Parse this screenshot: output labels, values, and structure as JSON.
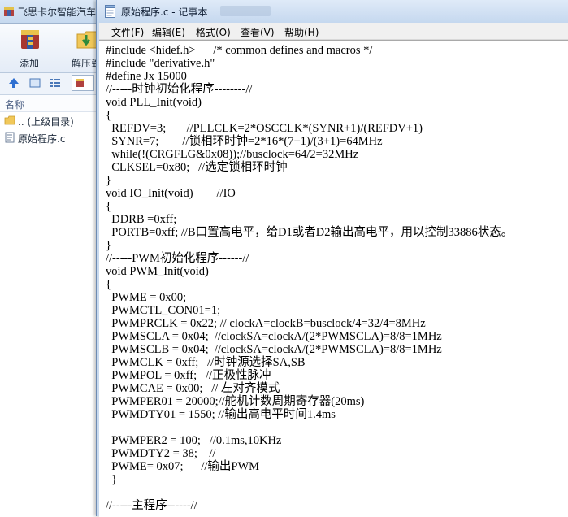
{
  "explorer": {
    "title": "飞思卡尔智能汽车",
    "ribbon": {
      "add_label": "添加",
      "extract_label": "解压到"
    },
    "list_header": "名称",
    "rows": [
      {
        "icon": "folder-up-icon",
        "label": ".. (上级目录)"
      },
      {
        "icon": "text-file-icon",
        "label": "原始程序.c"
      }
    ]
  },
  "notepad": {
    "title": "原始程序.c - 记事本",
    "menu": [
      {
        "label": "文件(F)"
      },
      {
        "label": "编辑(E)"
      },
      {
        "label": "格式(O)"
      },
      {
        "label": "查看(V)"
      },
      {
        "label": "帮助(H)"
      }
    ],
    "lines": [
      "#include <hidef.h>      /* common defines and macros */",
      "#include \"derivative.h\"",
      "#define Jx 15000",
      "//-----时钟初始化程序--------//",
      "void PLL_Init(void)",
      "{",
      "  REFDV=3;       //PLLCLK=2*OSCCLK*(SYNR+1)/(REFDV+1)",
      "  SYNR=7;        //锁相环时钟=2*16*(7+1)/(3+1)=64MHz",
      "  while(!(CRGFLG&0x08));//busclock=64/2=32MHz",
      "  CLKSEL=0x80;   //选定锁相环时钟",
      "}",
      "void IO_Init(void)        //IO",
      "{",
      "  DDRB =0xff;",
      "  PORTB=0xff; //B口置高电平，给D1或者D2输出高电平，用以控制33886状态。",
      "}",
      "//-----PWM初始化程序------//",
      "void PWM_Init(void)",
      "{",
      "  PWME = 0x00;",
      "  PWMCTL_CON01=1;",
      "  PWMPRCLK = 0x22; // clockA=clockB=busclock/4=32/4=8MHz",
      "  PWMSCLA = 0x04;  //clockSA=clockA/(2*PWMSCLA)=8/8=1MHz",
      "  PWMSCLB = 0x04;  //clockSA=clockA/(2*PWMSCLA)=8/8=1MHz",
      "  PWMCLK = 0xff;   //时钟源选择SA,SB",
      "  PWMPOL = 0xff;   //正极性脉冲",
      "  PWMCAE = 0x00;   // 左对齐模式",
      "  PWMPER01 = 20000;//舵机计数周期寄存器(20ms)",
      "  PWMDTY01 = 1550; //输出高电平时间1.4ms",
      "",
      "  PWMPER2 = 100;   //0.1ms,10KHz",
      "  PWMDTY2 = 38;    //",
      "  PWME= 0x07;      //输出PWM",
      "  }",
      "",
      "//-----主程序------//"
    ]
  }
}
